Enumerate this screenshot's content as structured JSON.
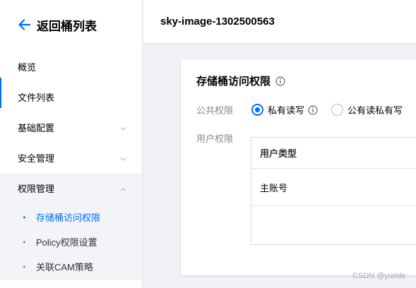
{
  "sidebar": {
    "back_label": "返回桶列表",
    "items": [
      {
        "label": "概览",
        "has_chevron": false
      },
      {
        "label": "文件列表",
        "has_chevron": false
      },
      {
        "label": "基础配置",
        "has_chevron": true
      },
      {
        "label": "安全管理",
        "has_chevron": true
      },
      {
        "label": "权限管理",
        "has_chevron": true
      }
    ],
    "subitems": [
      {
        "label": "存储桶访问权限",
        "active": true
      },
      {
        "label": "Policy权限设置",
        "active": false
      },
      {
        "label": "关联CAM策略",
        "active": false
      }
    ]
  },
  "header": {
    "bucket_name": "sky-image-1302500563"
  },
  "card": {
    "title": "存储桶访问权限",
    "public_permission_label": "公共权限",
    "radio_options": [
      {
        "label": "私有读写",
        "checked": true,
        "has_info": true
      },
      {
        "label": "公有读私有写",
        "checked": false,
        "has_info": false
      }
    ],
    "user_permission_label": "用户权限",
    "table": {
      "header": "用户类型",
      "rows": [
        "主账号"
      ]
    }
  },
  "watermark": "CSDN @yuride",
  "colors": {
    "accent": "#006eff",
    "sidebar_bg": "#ffffff",
    "page_bg": "#f1f2f5"
  }
}
